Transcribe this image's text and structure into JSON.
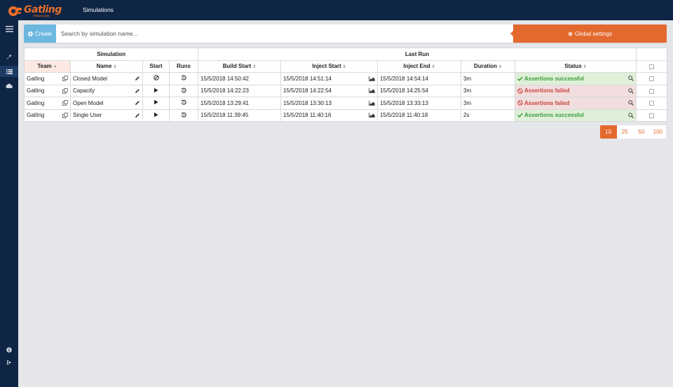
{
  "app": {
    "logo_text": "Gatling",
    "logo_sub": "FRONTLINE",
    "page_title": "Simulations"
  },
  "toolbar": {
    "create_label": "Create",
    "search_placeholder": "Search by simulation name...",
    "global_settings_label": "Global settings"
  },
  "sidebar": {
    "icons": [
      "menu-icon",
      "wrench-icon",
      "list-icon",
      "cloud-icon",
      "info-icon",
      "logout-icon"
    ]
  },
  "table": {
    "group_headers": {
      "simulation": "Simulation",
      "last_run": "Last Run"
    },
    "columns": {
      "team": "Team",
      "name": "Name",
      "start": "Start",
      "runs": "Runs",
      "build_start": "Build Start",
      "inject_start": "Inject Start",
      "inject_end": "Inject End",
      "duration": "Duration",
      "status": "Status"
    },
    "rows": [
      {
        "team": "Gatling",
        "name": "Closed Model",
        "start_icon": "disabled-icon",
        "build_start": "15/5/2018 14:50:42",
        "inject_start": "15/5/2018 14:51:14",
        "inject_end": "15/5/2018 14:54:14",
        "duration": "3m",
        "status": "Assertions successful",
        "status_type": "success"
      },
      {
        "team": "Gatling",
        "name": "Capacity",
        "start_icon": "play-icon",
        "build_start": "15/5/2018 14:22:23",
        "inject_start": "15/5/2018 14:22:54",
        "inject_end": "15/5/2018 14:25:54",
        "duration": "3m",
        "status": "Assertions failed",
        "status_type": "failed"
      },
      {
        "team": "Gatling",
        "name": "Open Model",
        "start_icon": "play-icon",
        "build_start": "15/5/2018 13:29:41",
        "inject_start": "15/5/2018 13:30:13",
        "inject_end": "15/5/2018 13:33:13",
        "duration": "3m",
        "status": "Assertions failed",
        "status_type": "failed"
      },
      {
        "team": "Gatling",
        "name": "Single User",
        "start_icon": "play-icon",
        "build_start": "15/5/2018 11:39:45",
        "inject_start": "15/5/2018 11:40:16",
        "inject_end": "15/5/2018 11:40:18",
        "duration": "2s",
        "status": "Assertions successful",
        "status_type": "success"
      }
    ]
  },
  "pagination": {
    "options": [
      "10",
      "25",
      "50",
      "100"
    ],
    "selected": "10"
  },
  "colors": {
    "navy": "#0f2545",
    "orange": "#e3692e",
    "blue": "#6db8e0",
    "success": "#3c9c3c",
    "failed": "#c9443f"
  }
}
